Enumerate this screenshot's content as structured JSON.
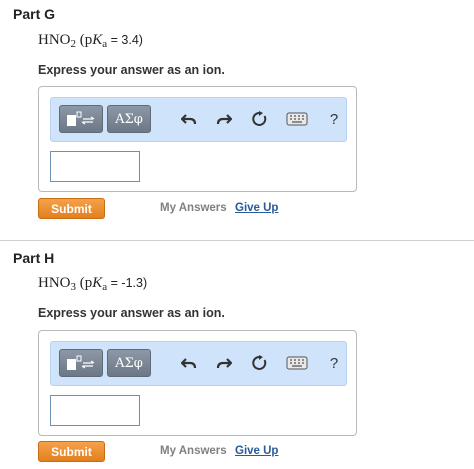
{
  "parts": [
    {
      "title": "Part G",
      "question": {
        "formula_main": "HNO",
        "formula_sub": "2",
        "pk_prefix": "(p",
        "pk_K": "K",
        "pk_sub": "a",
        "pk_value": " = 3.4)"
      },
      "instruction": "Express your answer as an ion.",
      "toolbar": {
        "greek_label": "ΑΣφ",
        "help_label": "?"
      },
      "answer_value": "",
      "submit_label": "Submit",
      "my_answers_label": "My Answers",
      "give_up_label": "Give Up"
    },
    {
      "title": "Part H",
      "question": {
        "formula_main": "HNO",
        "formula_sub": "3",
        "pk_prefix": "(p",
        "pk_K": "K",
        "pk_sub": "a",
        "pk_value": " = -1.3)"
      },
      "instruction": "Express your answer as an ion.",
      "toolbar": {
        "greek_label": "ΑΣφ",
        "help_label": "?"
      },
      "answer_value": "",
      "submit_label": "Submit",
      "my_answers_label": "My Answers",
      "give_up_label": "Give Up"
    }
  ],
  "icons": [
    "template-icon",
    "undo-icon",
    "redo-icon",
    "reset-icon",
    "keyboard-icon",
    "help-icon"
  ],
  "colors": {
    "submit": "#e88a2a",
    "toolbar": "#cfe4fb",
    "link": "#2a5a99"
  }
}
